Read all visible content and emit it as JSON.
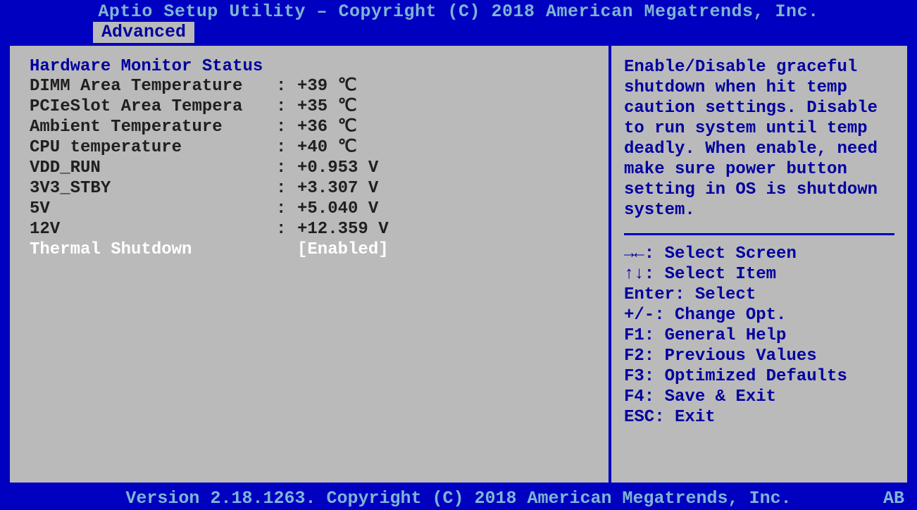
{
  "title": "Aptio Setup Utility – Copyright (C) 2018 American Megatrends, Inc.",
  "tab": {
    "label": "Advanced"
  },
  "section_title": "Hardware Monitor Status",
  "rows": [
    {
      "label": "DIMM Area Temperature",
      "sep": ": ",
      "value": "+39 ℃"
    },
    {
      "label": "PCIeSlot Area Tempera",
      "sep": ": ",
      "value": "+35 ℃"
    },
    {
      "label": "Ambient Temperature",
      "sep": ": ",
      "value": "+36 ℃"
    },
    {
      "label": "CPU temperature",
      "sep": ": ",
      "value": "+40 ℃"
    },
    {
      "label": "VDD_RUN",
      "sep": ": ",
      "value": "+0.953 V"
    },
    {
      "label": "3V3_STBY",
      "sep": ": ",
      "value": "+3.307 V"
    },
    {
      "label": "5V",
      "sep": ": ",
      "value": "+5.040 V"
    },
    {
      "label": "12V",
      "sep": ": ",
      "value": "+12.359 V"
    }
  ],
  "selected_row": {
    "label": "Thermal Shutdown",
    "sep": "",
    "value": "[Enabled]"
  },
  "help_text": "Enable/Disable graceful shutdown when hit temp caution settings. Disable to run system until temp deadly. When enable, need make sure power button setting in OS is shutdown system.",
  "key_hints": {
    "select_screen": "→←: Select Screen",
    "select_item": "↑↓: Select Item",
    "enter": "Enter: Select",
    "change": "+/-: Change Opt.",
    "f1": "F1: General Help",
    "f2": "F2: Previous Values",
    "f3": "F3: Optimized Defaults",
    "f4": "F4: Save & Exit",
    "esc": "ESC: Exit"
  },
  "footer": "Version 2.18.1263. Copyright (C) 2018 American Megatrends, Inc.",
  "corner": "AB"
}
